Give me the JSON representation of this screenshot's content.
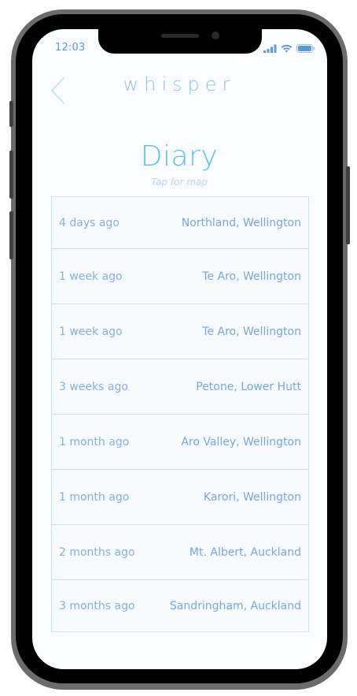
{
  "status_bar": {
    "time": "12:03",
    "icons": [
      "signal-icon",
      "wifi-icon",
      "battery-icon"
    ]
  },
  "nav": {
    "back_icon": "chevron-left-icon",
    "app_title": "whisper"
  },
  "page": {
    "title": "Diary",
    "subtitle": "Tap for map"
  },
  "diary": {
    "entries": [
      {
        "when": "4 days ago",
        "where": "Northland, Wellington"
      },
      {
        "when": "1 week ago",
        "where": "Te Aro, Wellington"
      },
      {
        "when": "1 week ago",
        "where": "Te Aro, Wellington"
      },
      {
        "when": "3 weeks ago",
        "where": "Petone, Lower Hutt"
      },
      {
        "when": "1 month ago",
        "where": "Aro Valley, Wellington"
      },
      {
        "when": "1 month ago",
        "where": "Karori, Wellington"
      },
      {
        "when": "2 months ago",
        "where": "Mt. Albert, Auckland"
      },
      {
        "when": "3 months ago",
        "where": "Sandringham, Auckland"
      }
    ]
  },
  "colors": {
    "accent": "#59c5ea",
    "text": "#74a8dc",
    "border": "#c6e3ee",
    "frame": "#6b6b6b"
  }
}
